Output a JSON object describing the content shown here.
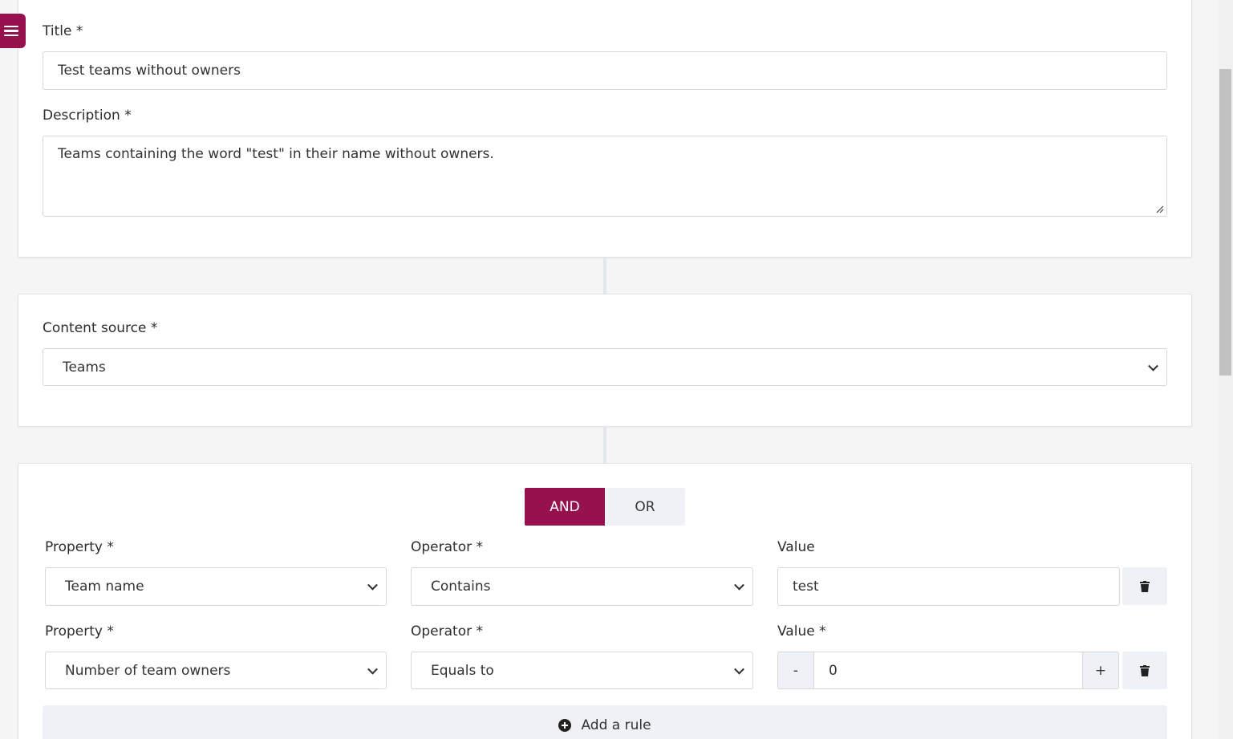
{
  "menu": {
    "icon": "hamburger-icon"
  },
  "details": {
    "title_label": "Title *",
    "title_value": "Test teams without owners",
    "description_label": "Description *",
    "description_value": "Teams containing the word \"test\" in their name without owners."
  },
  "source": {
    "label": "Content source *",
    "selected": "Teams"
  },
  "rules": {
    "logic": {
      "and_label": "AND",
      "or_label": "OR",
      "selected": "AND"
    },
    "rows": [
      {
        "property_label": "Property *",
        "property_value": "Team name",
        "operator_label": "Operator *",
        "operator_value": "Contains",
        "value_label": "Value",
        "value": "test"
      },
      {
        "property_label": "Property *",
        "property_value": "Number of team owners",
        "operator_label": "Operator *",
        "operator_value": "Equals to",
        "value_label": "Value *",
        "value": "0",
        "decrement_label": "-",
        "increment_label": "+"
      }
    ],
    "add_rule_label": "Add a rule"
  },
  "colors": {
    "accent": "#96124f",
    "button_bg": "#eef1f5",
    "page_bg": "#f5f5f5"
  }
}
